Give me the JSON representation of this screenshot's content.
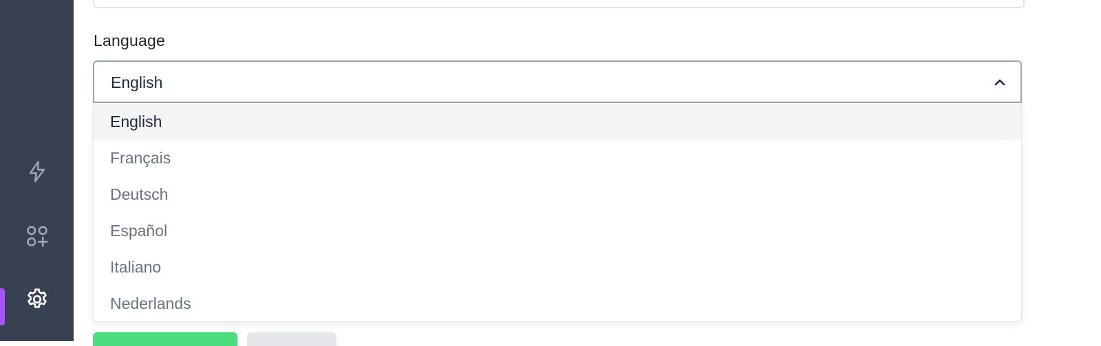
{
  "sidebar": {
    "items": [
      {
        "icon": "lightning-icon"
      },
      {
        "icon": "apps-add-icon"
      },
      {
        "icon": "gear-icon",
        "active": true
      }
    ],
    "active_color": "#a855f7"
  },
  "language": {
    "label": "Language",
    "selected": "English",
    "options": [
      "English",
      "Français",
      "Deutsch",
      "Español",
      "Italiano",
      "Nederlands"
    ]
  }
}
